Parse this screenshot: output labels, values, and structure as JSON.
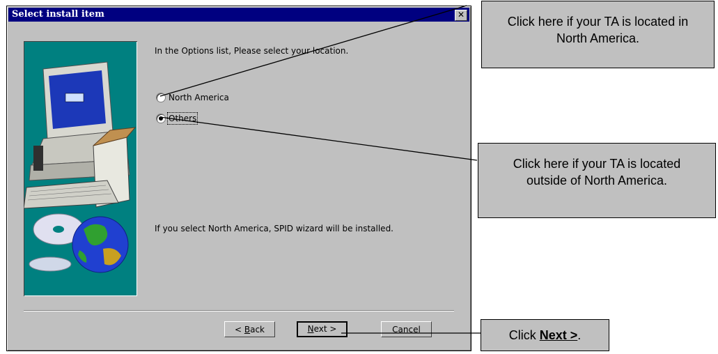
{
  "dialog": {
    "title": "Select install item",
    "close_glyph": "✕",
    "instruction": "In the Options list, Please select your location.",
    "options": [
      {
        "label": "North America",
        "selected": false
      },
      {
        "label": "Others",
        "selected": true
      }
    ],
    "note": "If you select North America, SPID wizard will be installed.",
    "buttons": {
      "back_prefix": "< ",
      "back_key": "B",
      "back_rest": "ack",
      "next_key": "N",
      "next_rest": "ext >",
      "cancel": "Cancel"
    }
  },
  "callouts": {
    "north_america": "Click here if your TA is located in North America.",
    "others": "Click here if your TA is located outside of North America.",
    "next_prefix": "Click ",
    "next_bold": "Next >",
    "next_suffix": "."
  },
  "colors": {
    "title_bar": "#000080",
    "dialog_bg": "#c0c0c0",
    "art_bg": "#008080"
  },
  "icons": [
    "computer-icon",
    "globe-icon",
    "cd-icon",
    "close-icon"
  ]
}
